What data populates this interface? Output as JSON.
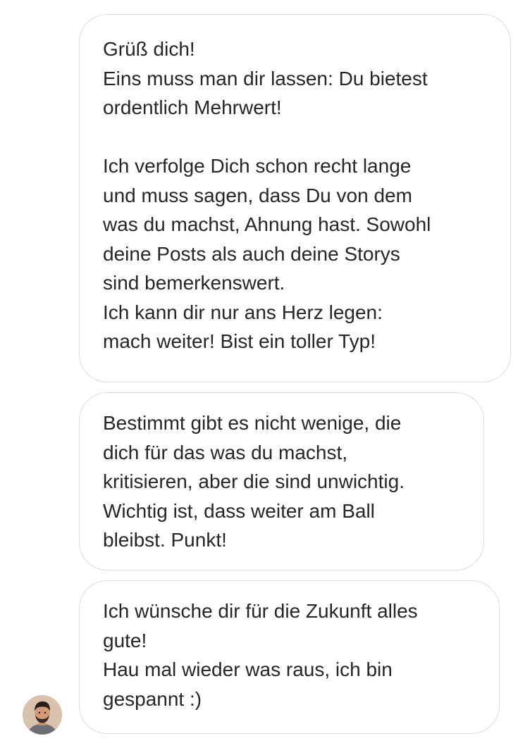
{
  "conversation": {
    "messages": [
      {
        "lines": [
          "Grüß dich!",
          "Eins muss man dir lassen: Du bietest",
          "ordentlich Mehrwert!",
          "",
          "Ich verfolge Dich schon recht lange",
          "und muss sagen, dass Du von dem",
          "was du machst, Ahnung hast. Sowohl",
          "deine Posts als auch deine Storys",
          "sind bemerkenswert.",
          "Ich kann dir nur ans Herz legen:",
          "mach weiter! Bist ein toller Typ!"
        ]
      },
      {
        "lines": [
          "Bestimmt gibt es nicht wenige, die",
          "dich für das was du machst,",
          "kritisieren, aber die sind unwichtig.",
          "Wichtig ist, dass weiter am Ball",
          "bleibst. Punkt!"
        ]
      },
      {
        "lines": [
          "Ich wünsche dir für die Zukunft alles",
          "gute!",
          "Hau mal wieder was raus, ich bin",
          "gespannt :)"
        ]
      }
    ],
    "sender_avatar_icon": "user-avatar"
  },
  "colors": {
    "bubble_border": "#dcdcdc",
    "text": "#262626",
    "background": "#ffffff"
  }
}
